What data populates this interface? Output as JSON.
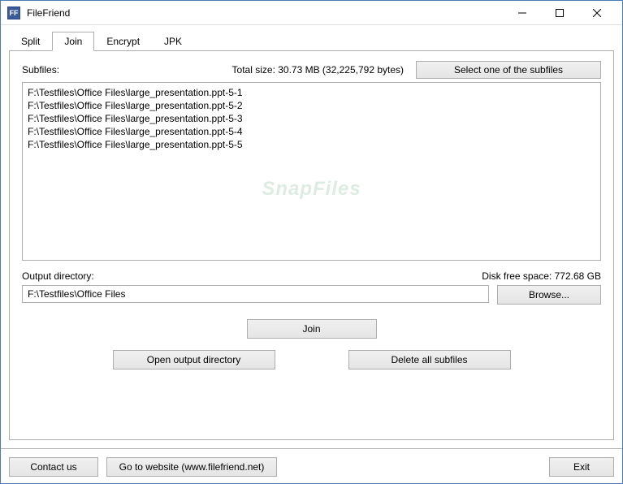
{
  "window": {
    "title": "FileFriend",
    "icon_text": "FF"
  },
  "tabs": {
    "items": [
      {
        "label": "Split"
      },
      {
        "label": "Join"
      },
      {
        "label": "Encrypt"
      },
      {
        "label": "JPK"
      }
    ],
    "active_index": 1
  },
  "subfiles": {
    "label": "Subfiles:",
    "total_size_label": "Total size: 30.73 MB (32,225,792 bytes)",
    "select_button": "Select one of the subfiles",
    "items": [
      "F:\\Testfiles\\Office Files\\large_presentation.ppt-5-1",
      "F:\\Testfiles\\Office Files\\large_presentation.ppt-5-2",
      "F:\\Testfiles\\Office Files\\large_presentation.ppt-5-3",
      "F:\\Testfiles\\Office Files\\large_presentation.ppt-5-4",
      "F:\\Testfiles\\Office Files\\large_presentation.ppt-5-5"
    ]
  },
  "output": {
    "label": "Output directory:",
    "disk_space_label": "Disk free space: 772.68 GB",
    "value": "F:\\Testfiles\\Office Files",
    "browse_button": "Browse..."
  },
  "actions": {
    "join": "Join",
    "open_output": "Open output directory",
    "delete_all": "Delete all subfiles"
  },
  "footer": {
    "contact": "Contact us",
    "website": "Go to website (www.filefriend.net)",
    "exit": "Exit"
  },
  "watermark": "SnapFiles"
}
